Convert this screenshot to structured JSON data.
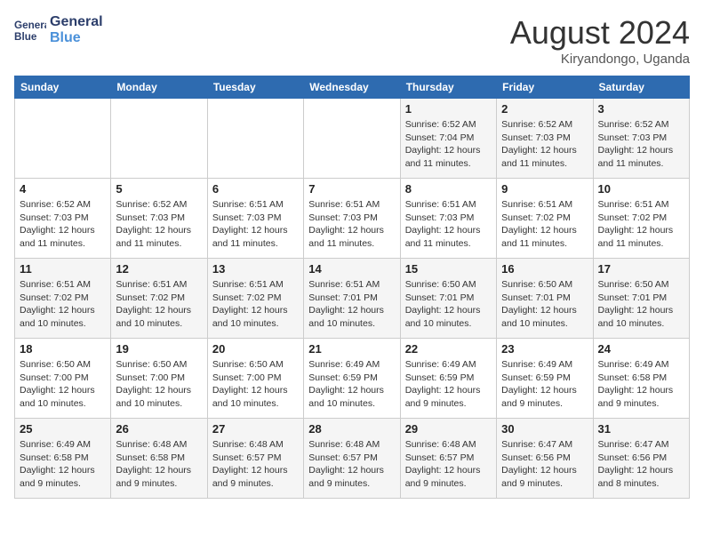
{
  "header": {
    "logo_line1": "General",
    "logo_line2": "Blue",
    "month": "August 2024",
    "location": "Kiryandongo, Uganda"
  },
  "weekdays": [
    "Sunday",
    "Monday",
    "Tuesday",
    "Wednesday",
    "Thursday",
    "Friday",
    "Saturday"
  ],
  "weeks": [
    [
      {
        "day": "",
        "info": ""
      },
      {
        "day": "",
        "info": ""
      },
      {
        "day": "",
        "info": ""
      },
      {
        "day": "",
        "info": ""
      },
      {
        "day": "1",
        "info": "Sunrise: 6:52 AM\nSunset: 7:04 PM\nDaylight: 12 hours and 11 minutes."
      },
      {
        "day": "2",
        "info": "Sunrise: 6:52 AM\nSunset: 7:03 PM\nDaylight: 12 hours and 11 minutes."
      },
      {
        "day": "3",
        "info": "Sunrise: 6:52 AM\nSunset: 7:03 PM\nDaylight: 12 hours and 11 minutes."
      }
    ],
    [
      {
        "day": "4",
        "info": "Sunrise: 6:52 AM\nSunset: 7:03 PM\nDaylight: 12 hours and 11 minutes."
      },
      {
        "day": "5",
        "info": "Sunrise: 6:52 AM\nSunset: 7:03 PM\nDaylight: 12 hours and 11 minutes."
      },
      {
        "day": "6",
        "info": "Sunrise: 6:51 AM\nSunset: 7:03 PM\nDaylight: 12 hours and 11 minutes."
      },
      {
        "day": "7",
        "info": "Sunrise: 6:51 AM\nSunset: 7:03 PM\nDaylight: 12 hours and 11 minutes."
      },
      {
        "day": "8",
        "info": "Sunrise: 6:51 AM\nSunset: 7:03 PM\nDaylight: 12 hours and 11 minutes."
      },
      {
        "day": "9",
        "info": "Sunrise: 6:51 AM\nSunset: 7:02 PM\nDaylight: 12 hours and 11 minutes."
      },
      {
        "day": "10",
        "info": "Sunrise: 6:51 AM\nSunset: 7:02 PM\nDaylight: 12 hours and 11 minutes."
      }
    ],
    [
      {
        "day": "11",
        "info": "Sunrise: 6:51 AM\nSunset: 7:02 PM\nDaylight: 12 hours and 10 minutes."
      },
      {
        "day": "12",
        "info": "Sunrise: 6:51 AM\nSunset: 7:02 PM\nDaylight: 12 hours and 10 minutes."
      },
      {
        "day": "13",
        "info": "Sunrise: 6:51 AM\nSunset: 7:02 PM\nDaylight: 12 hours and 10 minutes."
      },
      {
        "day": "14",
        "info": "Sunrise: 6:51 AM\nSunset: 7:01 PM\nDaylight: 12 hours and 10 minutes."
      },
      {
        "day": "15",
        "info": "Sunrise: 6:50 AM\nSunset: 7:01 PM\nDaylight: 12 hours and 10 minutes."
      },
      {
        "day": "16",
        "info": "Sunrise: 6:50 AM\nSunset: 7:01 PM\nDaylight: 12 hours and 10 minutes."
      },
      {
        "day": "17",
        "info": "Sunrise: 6:50 AM\nSunset: 7:01 PM\nDaylight: 12 hours and 10 minutes."
      }
    ],
    [
      {
        "day": "18",
        "info": "Sunrise: 6:50 AM\nSunset: 7:00 PM\nDaylight: 12 hours and 10 minutes."
      },
      {
        "day": "19",
        "info": "Sunrise: 6:50 AM\nSunset: 7:00 PM\nDaylight: 12 hours and 10 minutes."
      },
      {
        "day": "20",
        "info": "Sunrise: 6:50 AM\nSunset: 7:00 PM\nDaylight: 12 hours and 10 minutes."
      },
      {
        "day": "21",
        "info": "Sunrise: 6:49 AM\nSunset: 6:59 PM\nDaylight: 12 hours and 10 minutes."
      },
      {
        "day": "22",
        "info": "Sunrise: 6:49 AM\nSunset: 6:59 PM\nDaylight: 12 hours and 9 minutes."
      },
      {
        "day": "23",
        "info": "Sunrise: 6:49 AM\nSunset: 6:59 PM\nDaylight: 12 hours and 9 minutes."
      },
      {
        "day": "24",
        "info": "Sunrise: 6:49 AM\nSunset: 6:58 PM\nDaylight: 12 hours and 9 minutes."
      }
    ],
    [
      {
        "day": "25",
        "info": "Sunrise: 6:49 AM\nSunset: 6:58 PM\nDaylight: 12 hours and 9 minutes."
      },
      {
        "day": "26",
        "info": "Sunrise: 6:48 AM\nSunset: 6:58 PM\nDaylight: 12 hours and 9 minutes."
      },
      {
        "day": "27",
        "info": "Sunrise: 6:48 AM\nSunset: 6:57 PM\nDaylight: 12 hours and 9 minutes."
      },
      {
        "day": "28",
        "info": "Sunrise: 6:48 AM\nSunset: 6:57 PM\nDaylight: 12 hours and 9 minutes."
      },
      {
        "day": "29",
        "info": "Sunrise: 6:48 AM\nSunset: 6:57 PM\nDaylight: 12 hours and 9 minutes."
      },
      {
        "day": "30",
        "info": "Sunrise: 6:47 AM\nSunset: 6:56 PM\nDaylight: 12 hours and 9 minutes."
      },
      {
        "day": "31",
        "info": "Sunrise: 6:47 AM\nSunset: 6:56 PM\nDaylight: 12 hours and 8 minutes."
      }
    ]
  ]
}
